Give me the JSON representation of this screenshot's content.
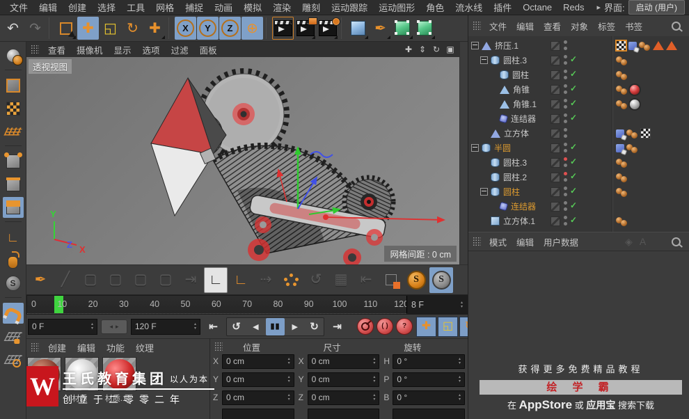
{
  "menubar": {
    "items": [
      "文件",
      "编辑",
      "创建",
      "选择",
      "工具",
      "网格",
      "捕捉",
      "动画",
      "模拟",
      "渲染",
      "雕刻",
      "运动跟踪",
      "运动图形",
      "角色",
      "流水线",
      "插件",
      "Octane",
      "Reds"
    ],
    "overflow_arrow": "▸",
    "interface_label": "界面:",
    "interface_value": "启动 (用户)"
  },
  "toolbar": {
    "buttons": [
      {
        "name": "undo-button",
        "icon": "undo-icon",
        "glyph": "↶",
        "color": "light"
      },
      {
        "name": "redo-button",
        "icon": "redo-icon",
        "glyph": "↷",
        "color": "light",
        "disabled": true
      },
      {
        "sep": true
      },
      {
        "name": "live-selection-button",
        "icon": "selection-cursor-icon",
        "kind": "select",
        "flyout": true
      },
      {
        "name": "move-tool-button",
        "icon": "move-arrows-icon",
        "glyph": "✚",
        "color": "orange",
        "active": true
      },
      {
        "name": "scale-tool-button",
        "icon": "scale-square-icon",
        "glyph": "◱",
        "color": "yellow"
      },
      {
        "name": "rotate-tool-button",
        "icon": "rotate-arrows-icon",
        "glyph": "↻",
        "color": "orange"
      },
      {
        "name": "last-tool-button",
        "icon": "move-arrows-icon",
        "glyph": "✚",
        "color": "orange",
        "flyout": true
      },
      {
        "sep": true
      },
      {
        "name": "lock-x-axis-button",
        "icon": "x-axis-icon",
        "glyph": "X",
        "circle": true,
        "active": true
      },
      {
        "name": "lock-y-axis-button",
        "icon": "y-axis-icon",
        "glyph": "Y",
        "circle": true,
        "active": true
      },
      {
        "name": "lock-z-axis-button",
        "icon": "z-axis-icon",
        "glyph": "Z",
        "circle": true,
        "active": true
      },
      {
        "name": "coordinate-system-button",
        "icon": "globe-axis-icon",
        "glyph": "⊕",
        "color": "orange",
        "active": true
      },
      {
        "sep": true
      },
      {
        "name": "render-view-button",
        "icon": "clapperboard-icon",
        "kind": "clapper",
        "selbox": true
      },
      {
        "name": "render-picture-viewer-button",
        "icon": "clapperboard-picture-icon",
        "kind": "clapper",
        "inner": "chip-pic",
        "flyout": true
      },
      {
        "name": "render-settings-button",
        "icon": "clapperboard-gear-icon",
        "kind": "clapper",
        "inner": "chip-gear",
        "flyout": true
      },
      {
        "sep": true
      },
      {
        "name": "add-primitive-button",
        "icon": "blue-cube-icon",
        "kind": "cube-blue",
        "flyout": true
      },
      {
        "name": "add-spline-button",
        "icon": "pen-nib-icon",
        "glyph": "✒",
        "color": "orange",
        "flyout": true
      },
      {
        "name": "add-generator-button",
        "icon": "green-cube-icon",
        "kind": "cube-green",
        "flyout": true
      },
      {
        "name": "add-deformer-button",
        "icon": "green-cube-icon",
        "kind": "cube-green",
        "flyout": true
      }
    ]
  },
  "left_toolbar": {
    "buttons": [
      {
        "name": "make-editable-button",
        "icon": "editable-sphere-icon",
        "kind": "editable"
      },
      {
        "sep": true
      },
      {
        "name": "model-mode-button",
        "icon": "model-cube-icon",
        "kind": "cube-outline"
      },
      {
        "name": "texture-mode-button",
        "icon": "texture-cube-icon",
        "kind": "cube-checker"
      },
      {
        "name": "workplane-mode-button",
        "icon": "workplane-grid-icon",
        "kind": "grid-orange"
      },
      {
        "sep": true
      },
      {
        "name": "points-mode-button",
        "icon": "points-cube-icon",
        "kind": "cube-points"
      },
      {
        "name": "edges-mode-button",
        "icon": "edges-cube-icon",
        "kind": "cube-edges"
      },
      {
        "name": "polygons-mode-button",
        "icon": "polygons-cube-icon",
        "kind": "cube-polys",
        "active": true
      },
      {
        "sep": true
      },
      {
        "name": "enable-axis-button",
        "icon": "axis-l-icon",
        "glyph": "∟",
        "color": "orange"
      },
      {
        "name": "viewport-solo-button",
        "icon": "mouse-icon",
        "kind": "mouse"
      },
      {
        "name": "snap-settings-button",
        "icon": "s-circle-icon",
        "kind": "s-gray-sm",
        "glyph": "S"
      },
      {
        "sep": true
      },
      {
        "name": "enable-snap-button",
        "icon": "magnet-icon",
        "kind": "magnet",
        "active": true
      },
      {
        "name": "lock-workplane-button",
        "icon": "workplane-lock-icon",
        "kind": "grid-lock"
      },
      {
        "name": "planar-workplane-button",
        "icon": "workplane-rotate-icon",
        "kind": "grid-rotate"
      }
    ]
  },
  "viewport": {
    "menu": [
      "查看",
      "摄像机",
      "显示",
      "选项",
      "过滤",
      "面板"
    ],
    "nav_buttons": [
      {
        "name": "viewport-pan-button",
        "icon": "pan-arrows-icon",
        "glyph": "✚"
      },
      {
        "name": "viewport-zoom-button",
        "icon": "zoom-arrows-icon",
        "glyph": "⇕"
      },
      {
        "name": "viewport-rotate-button",
        "icon": "orbit-icon",
        "glyph": "↻"
      },
      {
        "name": "viewport-toggle-button",
        "icon": "window-icon",
        "glyph": "▣"
      }
    ],
    "view_label": "透视视图",
    "grid_label": "网格间距 : 0 cm",
    "axis_x": "X",
    "axis_y": "Y",
    "axis_z": "Z"
  },
  "tool_palette": {
    "buttons": [
      {
        "name": "modeling-pen-button",
        "icon": "pen-nib-icon",
        "glyph": "✒",
        "color": "orange"
      },
      {
        "name": "knife-tool-button",
        "icon": "knife-icon",
        "glyph": "╱",
        "disabled": true
      },
      {
        "name": "polygon-tool-1-button",
        "icon": "wire-cube-icon",
        "glyph": "▢",
        "disabled": true
      },
      {
        "name": "polygon-tool-2-button",
        "icon": "wire-cube-icon",
        "glyph": "▢",
        "disabled": true
      },
      {
        "name": "polygon-tool-3-button",
        "icon": "wire-cube-icon",
        "glyph": "▢",
        "disabled": true
      },
      {
        "name": "polygon-tool-4-button",
        "icon": "wire-cube-icon",
        "glyph": "▢",
        "disabled": true
      },
      {
        "name": "mirror-tool-button",
        "icon": "mirror-arrow-icon",
        "glyph": "⇥",
        "disabled": true
      },
      {
        "name": "axis-edit-button",
        "icon": "axis-pen-icon",
        "glyph": "∟",
        "white": true
      },
      {
        "name": "axis-center-button",
        "icon": "axis-corner-icon",
        "glyph": "∟",
        "color": "orange"
      },
      {
        "name": "transfer-tool-button",
        "icon": "transfer-arrow-icon",
        "glyph": "⇢",
        "disabled": true
      },
      {
        "name": "arrange-tool-button",
        "icon": "dot-ring-icon",
        "kind": "dot-ring"
      },
      {
        "name": "reset-psr-button",
        "icon": "recycle-icon",
        "glyph": "↺",
        "disabled": true
      },
      {
        "name": "quantize-button",
        "icon": "grid-icon",
        "glyph": "▦",
        "disabled": true
      },
      {
        "name": "bars-tool-button",
        "icon": "bars-icon",
        "glyph": "⇤",
        "disabled": true
      },
      {
        "name": "selection-filter-button",
        "icon": "select-chip-icon",
        "kind": "sel-chip"
      },
      {
        "name": "snap-active-button",
        "icon": "s-orange-icon",
        "kind": "s-orange",
        "glyph": "S"
      },
      {
        "name": "snap-inactive-button",
        "icon": "s-gray-icon",
        "kind": "s-gray",
        "glyph": "S",
        "active": true
      }
    ]
  },
  "timeline": {
    "ticks": [
      "0",
      "10",
      "20",
      "30",
      "40",
      "50",
      "60",
      "70",
      "80",
      "90",
      "100",
      "110",
      "120"
    ],
    "current_frame": 8,
    "frame_field": "8 F"
  },
  "transport": {
    "start_value": "0 F",
    "end_value": "120 F",
    "range_left": "◂",
    "range_right": "▸",
    "pre_buttons": [
      {
        "name": "goto-start-button",
        "icon": "skip-start-icon",
        "glyph": "⇤"
      }
    ],
    "play_buttons": [
      {
        "name": "play-backwards-button",
        "icon": "play-back-icon",
        "glyph": "↺"
      },
      {
        "name": "previous-frame-button",
        "icon": "prev-frame-icon",
        "glyph": "◂"
      },
      {
        "name": "pause-button",
        "icon": "pause-icon",
        "glyph": "▮▮",
        "active": true
      },
      {
        "name": "next-frame-button",
        "icon": "next-frame-icon",
        "glyph": "▸"
      },
      {
        "name": "play-forwards-button",
        "icon": "play-icon",
        "glyph": "↻"
      }
    ],
    "post_buttons": [
      {
        "name": "goto-end-button",
        "icon": "skip-end-icon",
        "glyph": "⇥"
      }
    ],
    "record_buttons": [
      {
        "name": "record-keyframe-button",
        "icon": "key-icon",
        "inner": "key"
      },
      {
        "name": "autokey-button",
        "icon": "parentheses-icon",
        "glyph": "( )"
      },
      {
        "name": "keying-help-button",
        "icon": "question-icon",
        "glyph": "?"
      }
    ],
    "keying_buttons": [
      {
        "name": "key-position-toggle",
        "icon": "position-cross-icon",
        "glyph": "✚",
        "color": "orange",
        "active": true
      },
      {
        "name": "key-scale-toggle",
        "icon": "scale-square-icon",
        "glyph": "◱",
        "color": "yellow",
        "active": true
      },
      {
        "name": "key-rotation-toggle",
        "icon": "rotation-circle-icon",
        "glyph": "↻",
        "color": "orange",
        "active": true
      }
    ]
  },
  "materials": {
    "menu": [
      "创建",
      "编辑",
      "功能",
      "纹理"
    ],
    "items": [
      {
        "label": "",
        "ball": [
          "#d4937a",
          "#83392a",
          "#3a120a"
        ]
      },
      {
        "label": "材质",
        "ball": [
          "#ffffff",
          "#c9c9c9",
          "#6e6e6e"
        ]
      },
      {
        "label": "材质.1",
        "ball": [
          "#ff8a8a",
          "#cc2525",
          "#4e0707"
        ]
      }
    ]
  },
  "watermark": {
    "logo_letter": "W",
    "title": "王氏教育集团",
    "slogan": "以人为本",
    "subtitle": "创立于二零零二年"
  },
  "coordinates": {
    "titles": [
      "位置",
      "尺寸",
      "旋转"
    ],
    "groups": [
      {
        "rows": [
          {
            "label": "X",
            "value": "0 cm"
          },
          {
            "label": "Y",
            "value": "0 cm"
          },
          {
            "label": "Z",
            "value": "0 cm"
          }
        ]
      },
      {
        "rows": [
          {
            "label": "X",
            "value": "0 cm"
          },
          {
            "label": "Y",
            "value": "0 cm"
          },
          {
            "label": "Z",
            "value": "0 cm"
          }
        ]
      },
      {
        "rows": [
          {
            "label": "H",
            "value": "0 °"
          },
          {
            "label": "P",
            "value": "0 °"
          },
          {
            "label": "B",
            "value": "0 °"
          }
        ]
      }
    ]
  },
  "object_manager": {
    "menu": [
      "文件",
      "编辑",
      "查看",
      "对象",
      "标签",
      "书签"
    ],
    "check": "✓",
    "tree": [
      {
        "depth": 0,
        "expander": true,
        "icon": "extrude",
        "name": "挤压.1",
        "tags": [
          "checker-sel",
          "blue",
          "dots",
          "tri",
          "tri"
        ]
      },
      {
        "depth": 1,
        "expander": true,
        "icon": "cylinder",
        "name": "圆柱.3",
        "check": true,
        "tags": [
          "dots"
        ]
      },
      {
        "depth": 2,
        "icon": "cylinder",
        "name": "圆柱",
        "check": true,
        "tags": [
          "dots"
        ]
      },
      {
        "depth": 2,
        "icon": "cone",
        "name": "角锥",
        "check": true,
        "tags": [
          "dots",
          "sphere-red"
        ]
      },
      {
        "depth": 2,
        "icon": "cone",
        "name": "角锥.1",
        "check": true,
        "tags": [
          "dots",
          "sphere-gray"
        ]
      },
      {
        "depth": 2,
        "icon": "connector",
        "name": "连结器",
        "check": true,
        "tags": []
      },
      {
        "depth": 1,
        "icon": "extrude",
        "name": "立方体",
        "tags": [
          "blue",
          "dots",
          "checker"
        ]
      },
      {
        "depth": 0,
        "expander": true,
        "icon": "cylinder",
        "name": "半圆",
        "selected": true,
        "check": true,
        "tags": [
          "blue",
          "dots"
        ]
      },
      {
        "depth": 1,
        "icon": "cylinder",
        "name": "圆柱.3",
        "check": true,
        "top": "red",
        "tags": [
          "dots"
        ]
      },
      {
        "depth": 1,
        "icon": "cylinder",
        "name": "圆柱.2",
        "check": true,
        "top": "red",
        "tags": [
          "dots"
        ]
      },
      {
        "depth": 1,
        "expander": true,
        "icon": "cylinder",
        "name": "圆柱",
        "selected": true,
        "check": true,
        "tags": [
          "dots"
        ]
      },
      {
        "depth": 2,
        "icon": "connector",
        "name": "连结器",
        "selected": true,
        "check": true,
        "tags": []
      },
      {
        "depth": 1,
        "icon": "cube",
        "name": "立方体.1",
        "check": true,
        "tags": [
          "dots"
        ]
      }
    ]
  },
  "attribute_manager": {
    "menu": [
      "模式",
      "编辑",
      "用户数据"
    ],
    "ghost_buttons": [
      {
        "name": "ghost-gizmo-icon",
        "glyph": "◈",
        "disabled": true
      },
      {
        "name": "ghost-letter-icon",
        "glyph": "A",
        "disabled": true
      }
    ]
  },
  "ad": {
    "line1": "获得更多免费精品教程",
    "line2": "绘 学 霸",
    "line3_pre": "在",
    "line3_store": "AppStore",
    "line3_or": "或",
    "line3_store2": "应用宝",
    "line3_suffix": "搜索下载"
  },
  "ui": {
    "stepper_up": "▴",
    "stepper_down": "▾"
  }
}
